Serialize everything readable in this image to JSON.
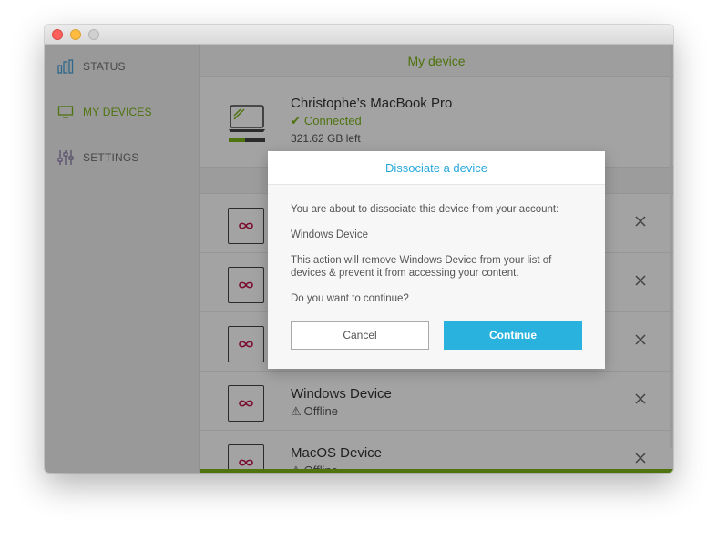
{
  "colors": {
    "accent_green": "#7cb518",
    "accent_blue": "#29b2de",
    "dialog_title_blue": "#29a8dc",
    "infinity_red": "#c0144a",
    "sidebar_icon_purple": "#8a7aa8",
    "status_icon_blue": "#4aa0d8"
  },
  "sidebar": {
    "items": [
      {
        "label": "STATUS",
        "icon": "bar-chart-icon",
        "active": false
      },
      {
        "label": "MY DEVICES",
        "icon": "monitor-icon",
        "active": true
      },
      {
        "label": "SETTINGS",
        "icon": "sliders-icon",
        "active": false
      }
    ]
  },
  "header": {
    "title": "My device"
  },
  "my_device": {
    "name": "Christophe’s MacBook Pro",
    "status": "Connected",
    "storage": "321.62 GB left",
    "storage_used_fraction": 0.45
  },
  "devices": [
    {
      "name": "",
      "status": ""
    },
    {
      "name": "",
      "status": ""
    },
    {
      "name": "",
      "status": ""
    },
    {
      "name": "Windows Device",
      "status": "Offline"
    },
    {
      "name": "MacOS Device",
      "status": "Offline"
    }
  ],
  "dialog": {
    "title": "Dissociate a device",
    "line1": "You are about to dissociate this device from your account:",
    "device_name": "Windows Device",
    "line3": "This action will remove Windows Device from your list of devices & prevent it from accessing your content.",
    "question": "Do you want to continue?",
    "cancel_label": "Cancel",
    "continue_label": "Continue"
  }
}
